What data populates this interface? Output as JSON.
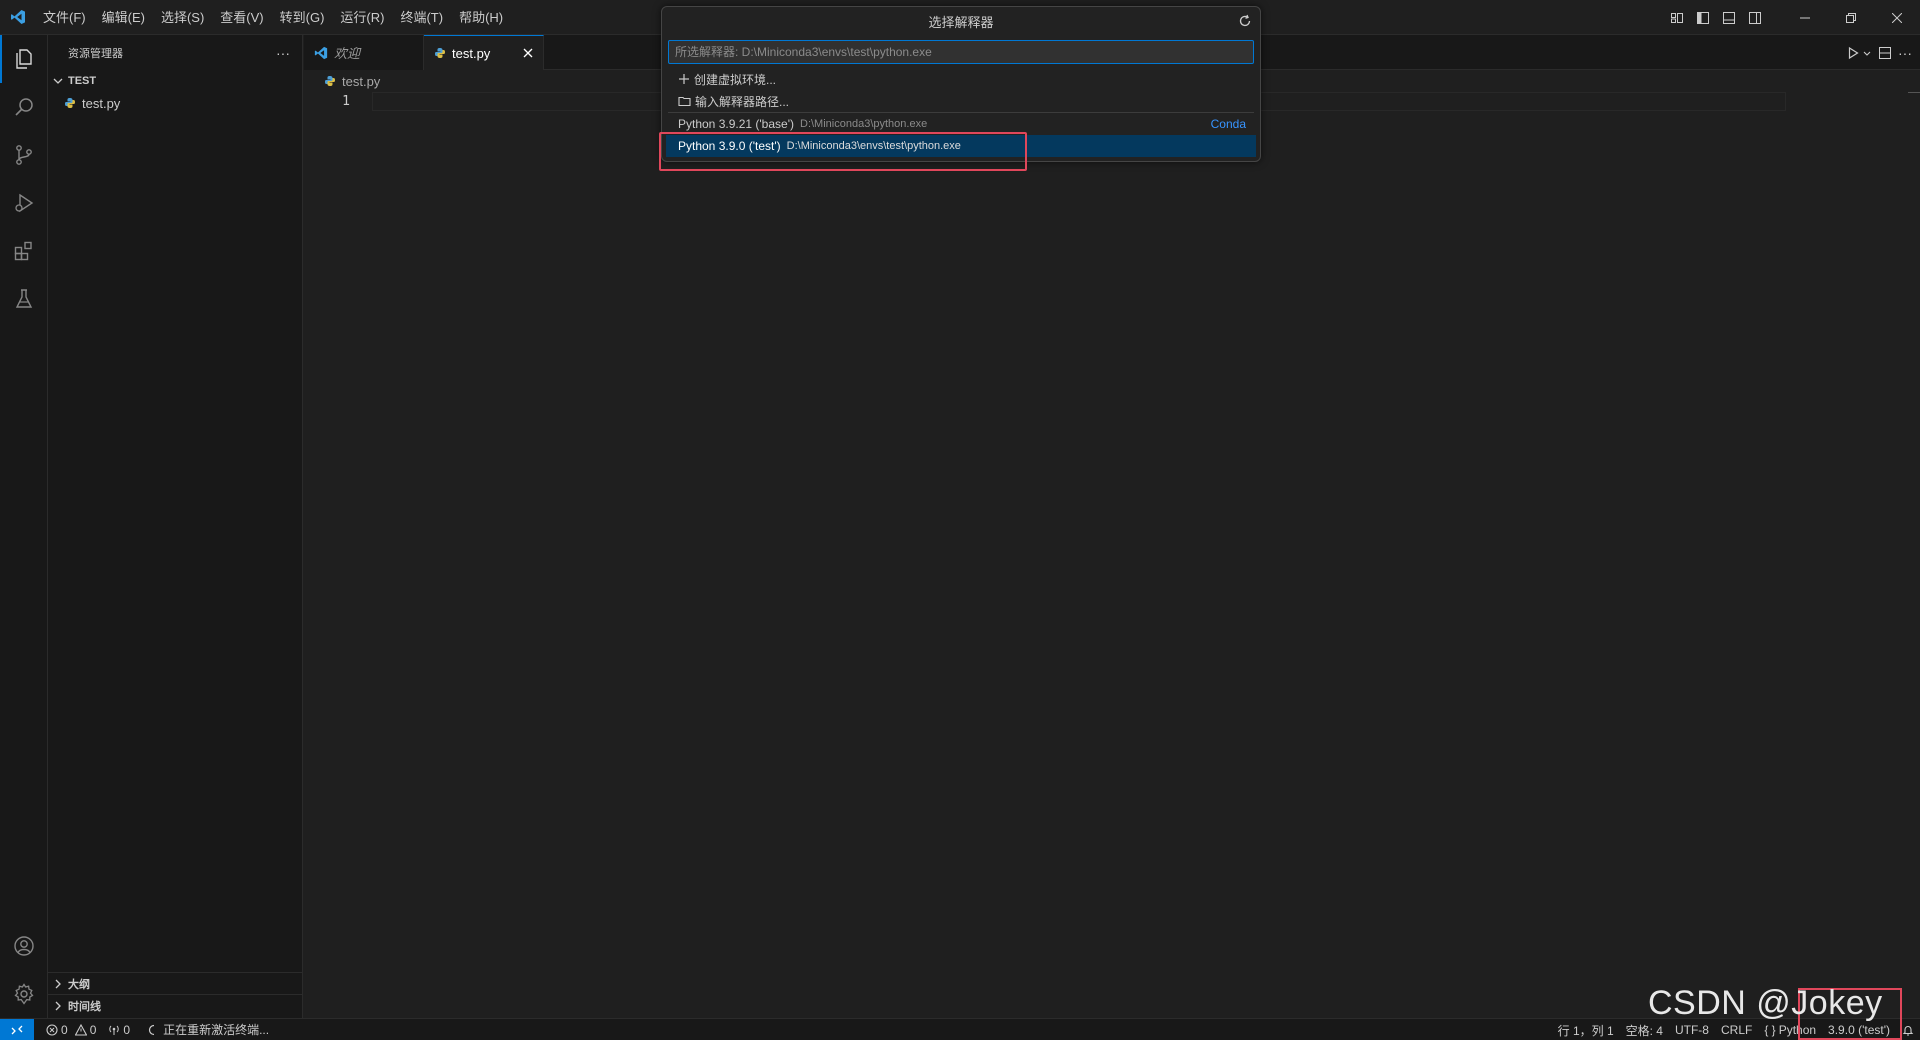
{
  "titlebar": {
    "menu": [
      "文件(F)",
      "编辑(E)",
      "选择(S)",
      "查看(V)",
      "转到(G)",
      "运行(R)",
      "终端(T)",
      "帮助(H)"
    ]
  },
  "sidebar": {
    "title": "资源管理器",
    "more": "···",
    "folder": "TEST",
    "files": [
      "test.py"
    ],
    "outline": "大纲",
    "timeline": "时间线"
  },
  "tabs": [
    {
      "label": "欢迎",
      "active": false
    },
    {
      "label": "test.py",
      "active": true
    }
  ],
  "breadcrumb": "test.py",
  "editor": {
    "line_number": "1"
  },
  "quickpick": {
    "title": "选择解释器",
    "placeholder": "所选解释器: D:\\Miniconda3\\envs\\test\\python.exe",
    "create_env": "创建虚拟环境...",
    "enter_path": "输入解释器路径...",
    "items": [
      {
        "label": "Python 3.9.21 ('base')",
        "path": "D:\\Miniconda3\\python.exe",
        "tag": "Conda"
      },
      {
        "label": "Python 3.9.0 ('test')",
        "path": "D:\\Miniconda3\\envs\\test\\python.exe",
        "tag": ""
      }
    ]
  },
  "statusbar": {
    "errors": "0",
    "warnings": "0",
    "ports": "0",
    "activity": "正在重新激活终端...",
    "position": "行 1，列 1",
    "spaces": "空格: 4",
    "encoding": "UTF-8",
    "eol": "CRLF",
    "language": "Python",
    "interpreter": "3.9.0 ('test')"
  },
  "watermark": "CSDN @Jokey",
  "colors": {
    "accent": "#0078d4",
    "highlight": "#e0475b",
    "selection": "#04395e",
    "link": "#3794ff"
  }
}
